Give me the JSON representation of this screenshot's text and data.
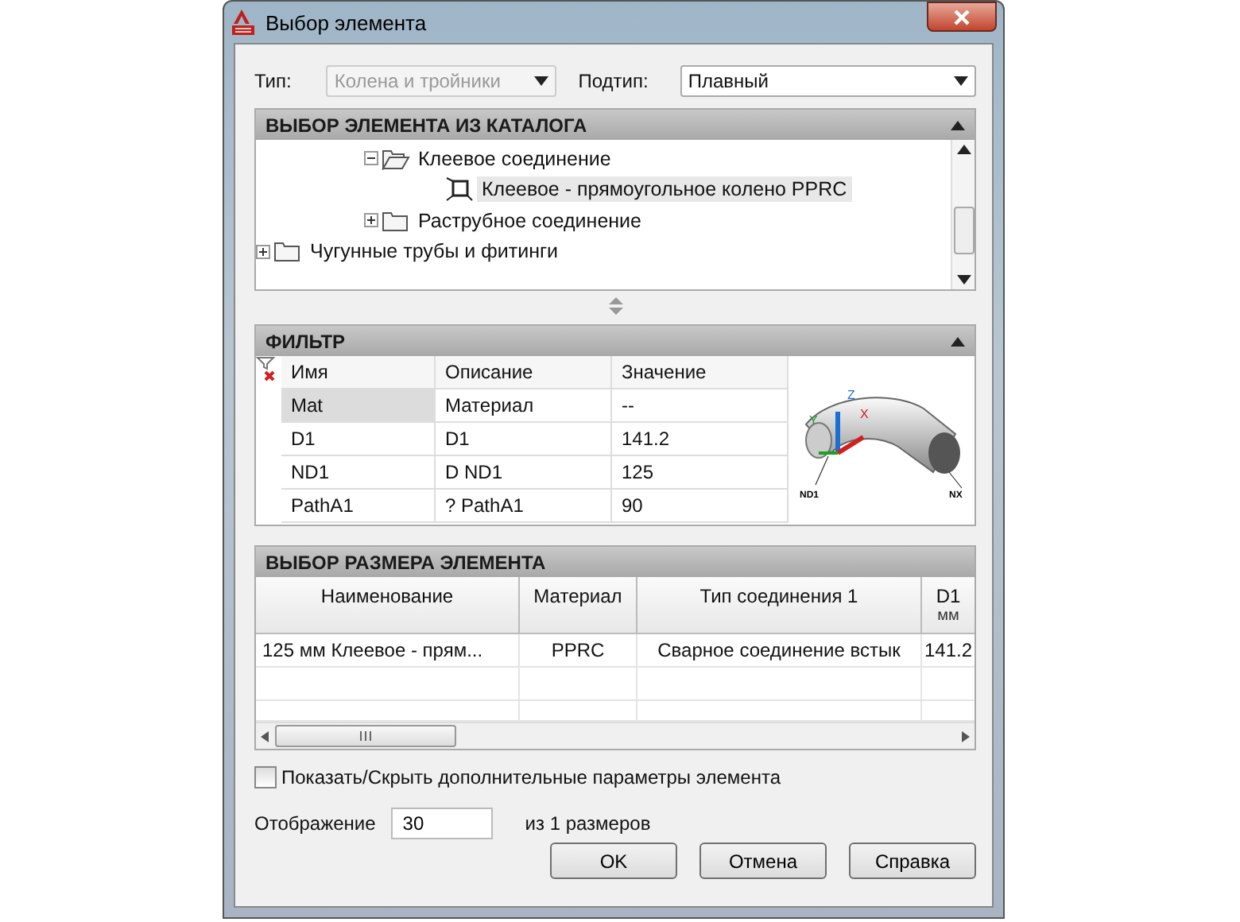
{
  "window": {
    "title": "Выбор элемента"
  },
  "type_row": {
    "type_label": "Тип:",
    "type_value": "Колена и тройники",
    "type_disabled": true,
    "subtype_label": "Подтип:",
    "subtype_value": "Плавный"
  },
  "catalog": {
    "title": "ВЫБОР ЭЛЕМЕНТА ИЗ КАТАЛОГА",
    "tree": [
      {
        "children": [
          {
            "children": [
              {
                "label": "Клеевое соединение",
                "kind": "folder",
                "expanded": true,
                "selected": false,
                "children": [
                  {
                    "label": "Клеевое - прямоугольное колено PPRC",
                    "kind": "part",
                    "selected": true
                  }
                ]
              },
              {
                "label": "Раструбное соединение",
                "kind": "folder",
                "expanded": false,
                "selected": false
              }
            ]
          }
        ]
      },
      {
        "label": "Чугунные трубы и фитинги",
        "kind": "folder",
        "expanded": false,
        "selected": false
      }
    ]
  },
  "filter": {
    "title": "ФИЛЬТР",
    "columns": [
      "Имя",
      "Описание",
      "Значение"
    ],
    "rows": [
      {
        "cells": [
          "Mat",
          "Материал",
          "--"
        ],
        "selected": true
      },
      {
        "cells": [
          "D1",
          "D1",
          "141.2"
        ],
        "selected": false
      },
      {
        "cells": [
          "ND1",
          "D ND1",
          "125"
        ],
        "selected": false
      },
      {
        "cells": [
          "PathA1",
          "? PathA1",
          "90"
        ],
        "selected": false
      }
    ],
    "preview": {
      "axis_labels": [
        "Z",
        "Y",
        "X"
      ],
      "labels": [
        "ND1",
        "NX"
      ]
    }
  },
  "sizes": {
    "title": "ВЫБОР РАЗМЕРА ЭЛЕМЕНТА",
    "columns": [
      {
        "label": "Наименование"
      },
      {
        "label": "Материал"
      },
      {
        "label": "Тип соединения 1"
      },
      {
        "label": "D1",
        "unit": "мм"
      }
    ],
    "rows": [
      [
        "125 мм Клеевое - прям...",
        "PPRC",
        "Сварное соединение встык",
        "141.2"
      ]
    ]
  },
  "show_params": {
    "label": "Показать/Скрыть дополнительные параметры элемента",
    "checked": false
  },
  "display": {
    "label": "Отображение",
    "value": "30",
    "suffix": "из 1 размеров"
  },
  "buttons": [
    "OK",
    "Отмена",
    "Справка"
  ]
}
